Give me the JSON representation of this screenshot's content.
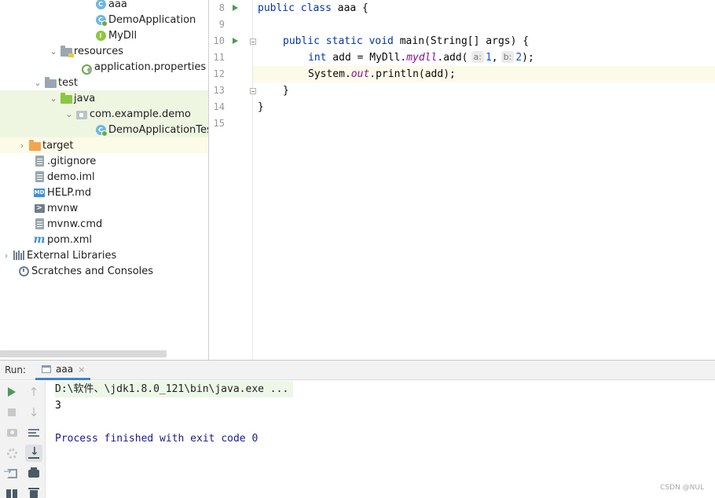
{
  "project_tree": {
    "items": [
      {
        "label": "aaa"
      },
      {
        "label": "DemoApplication"
      },
      {
        "label": "MyDll"
      },
      {
        "label": "resources"
      },
      {
        "label": "application.properties"
      },
      {
        "label": "test"
      },
      {
        "label": "java"
      },
      {
        "label": "com.example.demo"
      },
      {
        "label": "DemoApplicationTests"
      },
      {
        "label": "target"
      },
      {
        "label": ".gitignore"
      },
      {
        "label": "demo.iml"
      },
      {
        "label": "HELP.md"
      },
      {
        "label": "mvnw"
      },
      {
        "label": "mvnw.cmd"
      },
      {
        "label": "pom.xml"
      },
      {
        "label": "External Libraries"
      },
      {
        "label": "Scratches and Consoles"
      }
    ]
  },
  "icons": {
    "class": "C",
    "interface": "I",
    "markdown": "MD",
    "terminal": ">",
    "maven": "m"
  },
  "editor": {
    "line_numbers": [
      "8",
      "9",
      "10",
      "11",
      "12",
      "13",
      "14",
      "15"
    ],
    "code": {
      "l8_kw": "public class",
      "l8_rest": " aaa {",
      "l10_kw": "public static void",
      "l10_rest": " main(String[] args) {",
      "l11_kw": "int",
      "l11_a": " add = MyDll.",
      "l11_field": "mydll",
      "l11_b": ".add(",
      "l11_hint_a": "a:",
      "l11_num_a": "1",
      "l11_comma": ",",
      "l11_hint_b": "b:",
      "l11_num_b": "2",
      "l11_end": ");",
      "l12_a": "System.",
      "l12_field": "out",
      "l12_b": ".println(add);",
      "l13": "}",
      "l14": "}"
    }
  },
  "run_panel": {
    "label": "Run:",
    "tab_label": "aaa",
    "tab_close": "×",
    "toolbar": {
      "up_arrow": "↑",
      "down_arrow": "↓"
    },
    "console": {
      "command": "D:\\软件、\\jdk1.8.0_121\\bin\\java.exe ...",
      "output": "3",
      "exit": "Process finished with exit code 0"
    }
  },
  "watermark": "CSDN @NUL",
  "colors": {
    "keyword": "#0033b3",
    "field": "#871094",
    "number": "#1750eb",
    "run_green": "#499c54",
    "selection": "#eef6e2",
    "current_line": "#fcfae9"
  }
}
